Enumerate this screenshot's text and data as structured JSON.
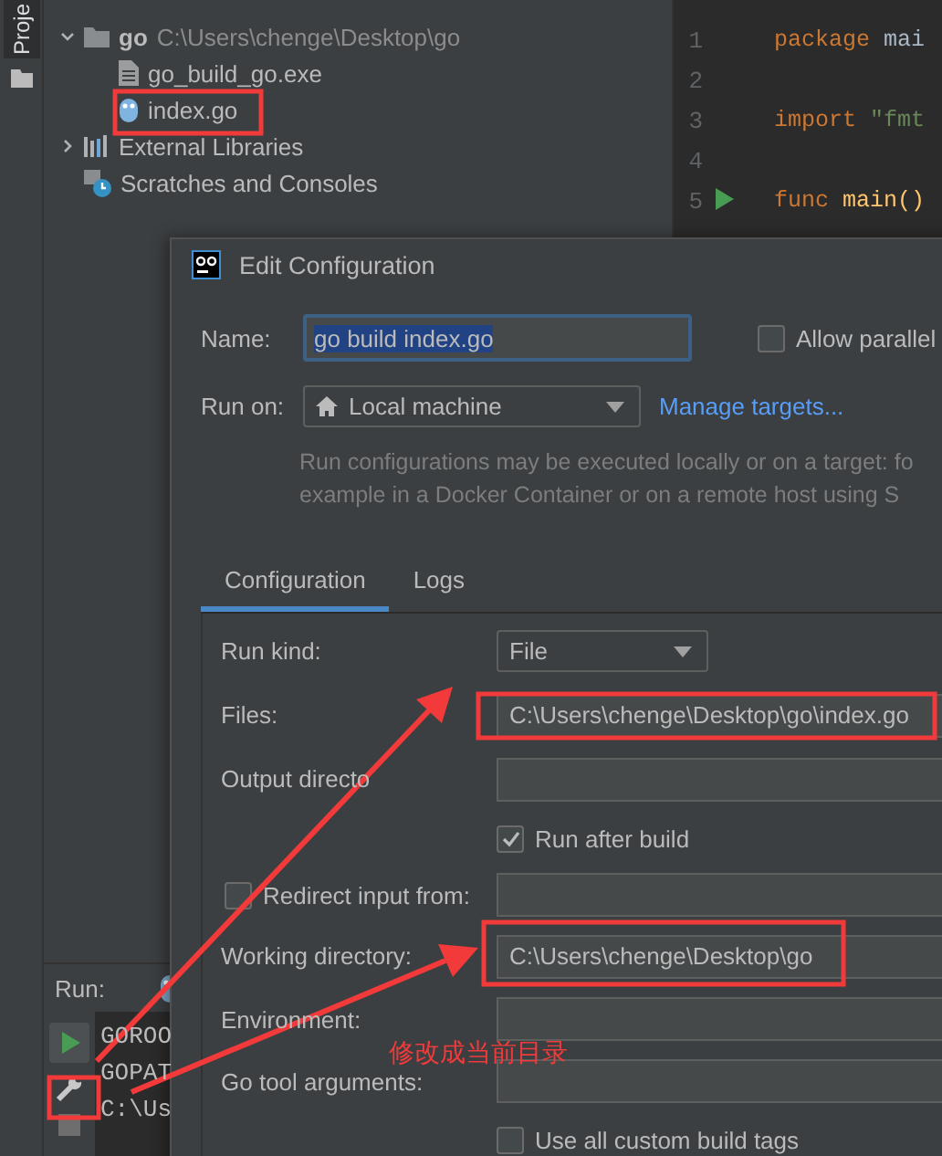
{
  "sidebar_tab": {
    "label": "Proje"
  },
  "project_tree": [
    {
      "name": "go",
      "path": "C:\\Users\\chenge\\Desktop\\go",
      "kind": "folder",
      "expanded": true,
      "children": [
        {
          "name": "go_build_go.exe",
          "kind": "file"
        },
        {
          "name": "index.go",
          "kind": "gofile"
        }
      ]
    },
    {
      "name": "External Libraries",
      "kind": "libraries",
      "expanded": false
    },
    {
      "name": "Scratches and Consoles",
      "kind": "scratches"
    }
  ],
  "editor": {
    "lines": [
      {
        "number": "1",
        "runnable": false,
        "tokens": [
          {
            "text": "package ",
            "kind": "keyword"
          },
          {
            "text": "mai",
            "kind": "plain"
          }
        ]
      },
      {
        "number": "2",
        "runnable": false
      },
      {
        "number": "3",
        "runnable": false,
        "tokens": [
          {
            "text": "import ",
            "kind": "keyword"
          },
          {
            "text": "\"fmt",
            "kind": "string"
          }
        ]
      },
      {
        "number": "4",
        "runnable": false
      },
      {
        "number": "5",
        "runnable": true,
        "tokens": [
          {
            "text": "func ",
            "kind": "keyword"
          },
          {
            "text": "main()",
            "kind": "function"
          }
        ]
      }
    ]
  },
  "run_panel": {
    "title": "Run:",
    "console": [
      "GOROO",
      "GOPAT",
      "C:\\Us"
    ]
  },
  "dialog": {
    "title": "Edit Configuration",
    "name_label": "Name:",
    "name_value": "go build index.go",
    "allow_parallel": {
      "label": "Allow parallel",
      "checked": false
    },
    "run_on_label": "Run on:",
    "run_on_value": "Local machine",
    "manage_link": "Manage targets...",
    "description": [
      "Run configurations may be executed locally or on a target: fo",
      "example in a Docker Container or on a remote host using S"
    ],
    "tabs": [
      {
        "label": "Configuration",
        "selected": true
      },
      {
        "label": "Logs",
        "selected": false
      }
    ],
    "fields": [
      {
        "kind": "dropdown",
        "label": "Run kind:",
        "value": "File"
      },
      {
        "kind": "text",
        "label": "Files:",
        "value": "C:\\Users\\chenge\\Desktop\\go\\index.go"
      },
      {
        "kind": "text",
        "label": "Output directo"
      },
      {
        "kind": "checkbox",
        "label": "Run after build",
        "checked": true
      },
      {
        "kind": "checkbox_field",
        "label": "Redirect input from:",
        "checked": false
      },
      {
        "kind": "text",
        "label": "Working directory:",
        "value": "C:\\Users\\chenge\\Desktop\\go"
      },
      {
        "kind": "text",
        "label": "Environment:"
      },
      {
        "kind": "text",
        "label": "Go tool arguments:"
      },
      {
        "kind": "checkbox",
        "label": "Use all custom build tags",
        "checked": false
      }
    ]
  },
  "annotation": {
    "note": "修改成当前目录"
  }
}
